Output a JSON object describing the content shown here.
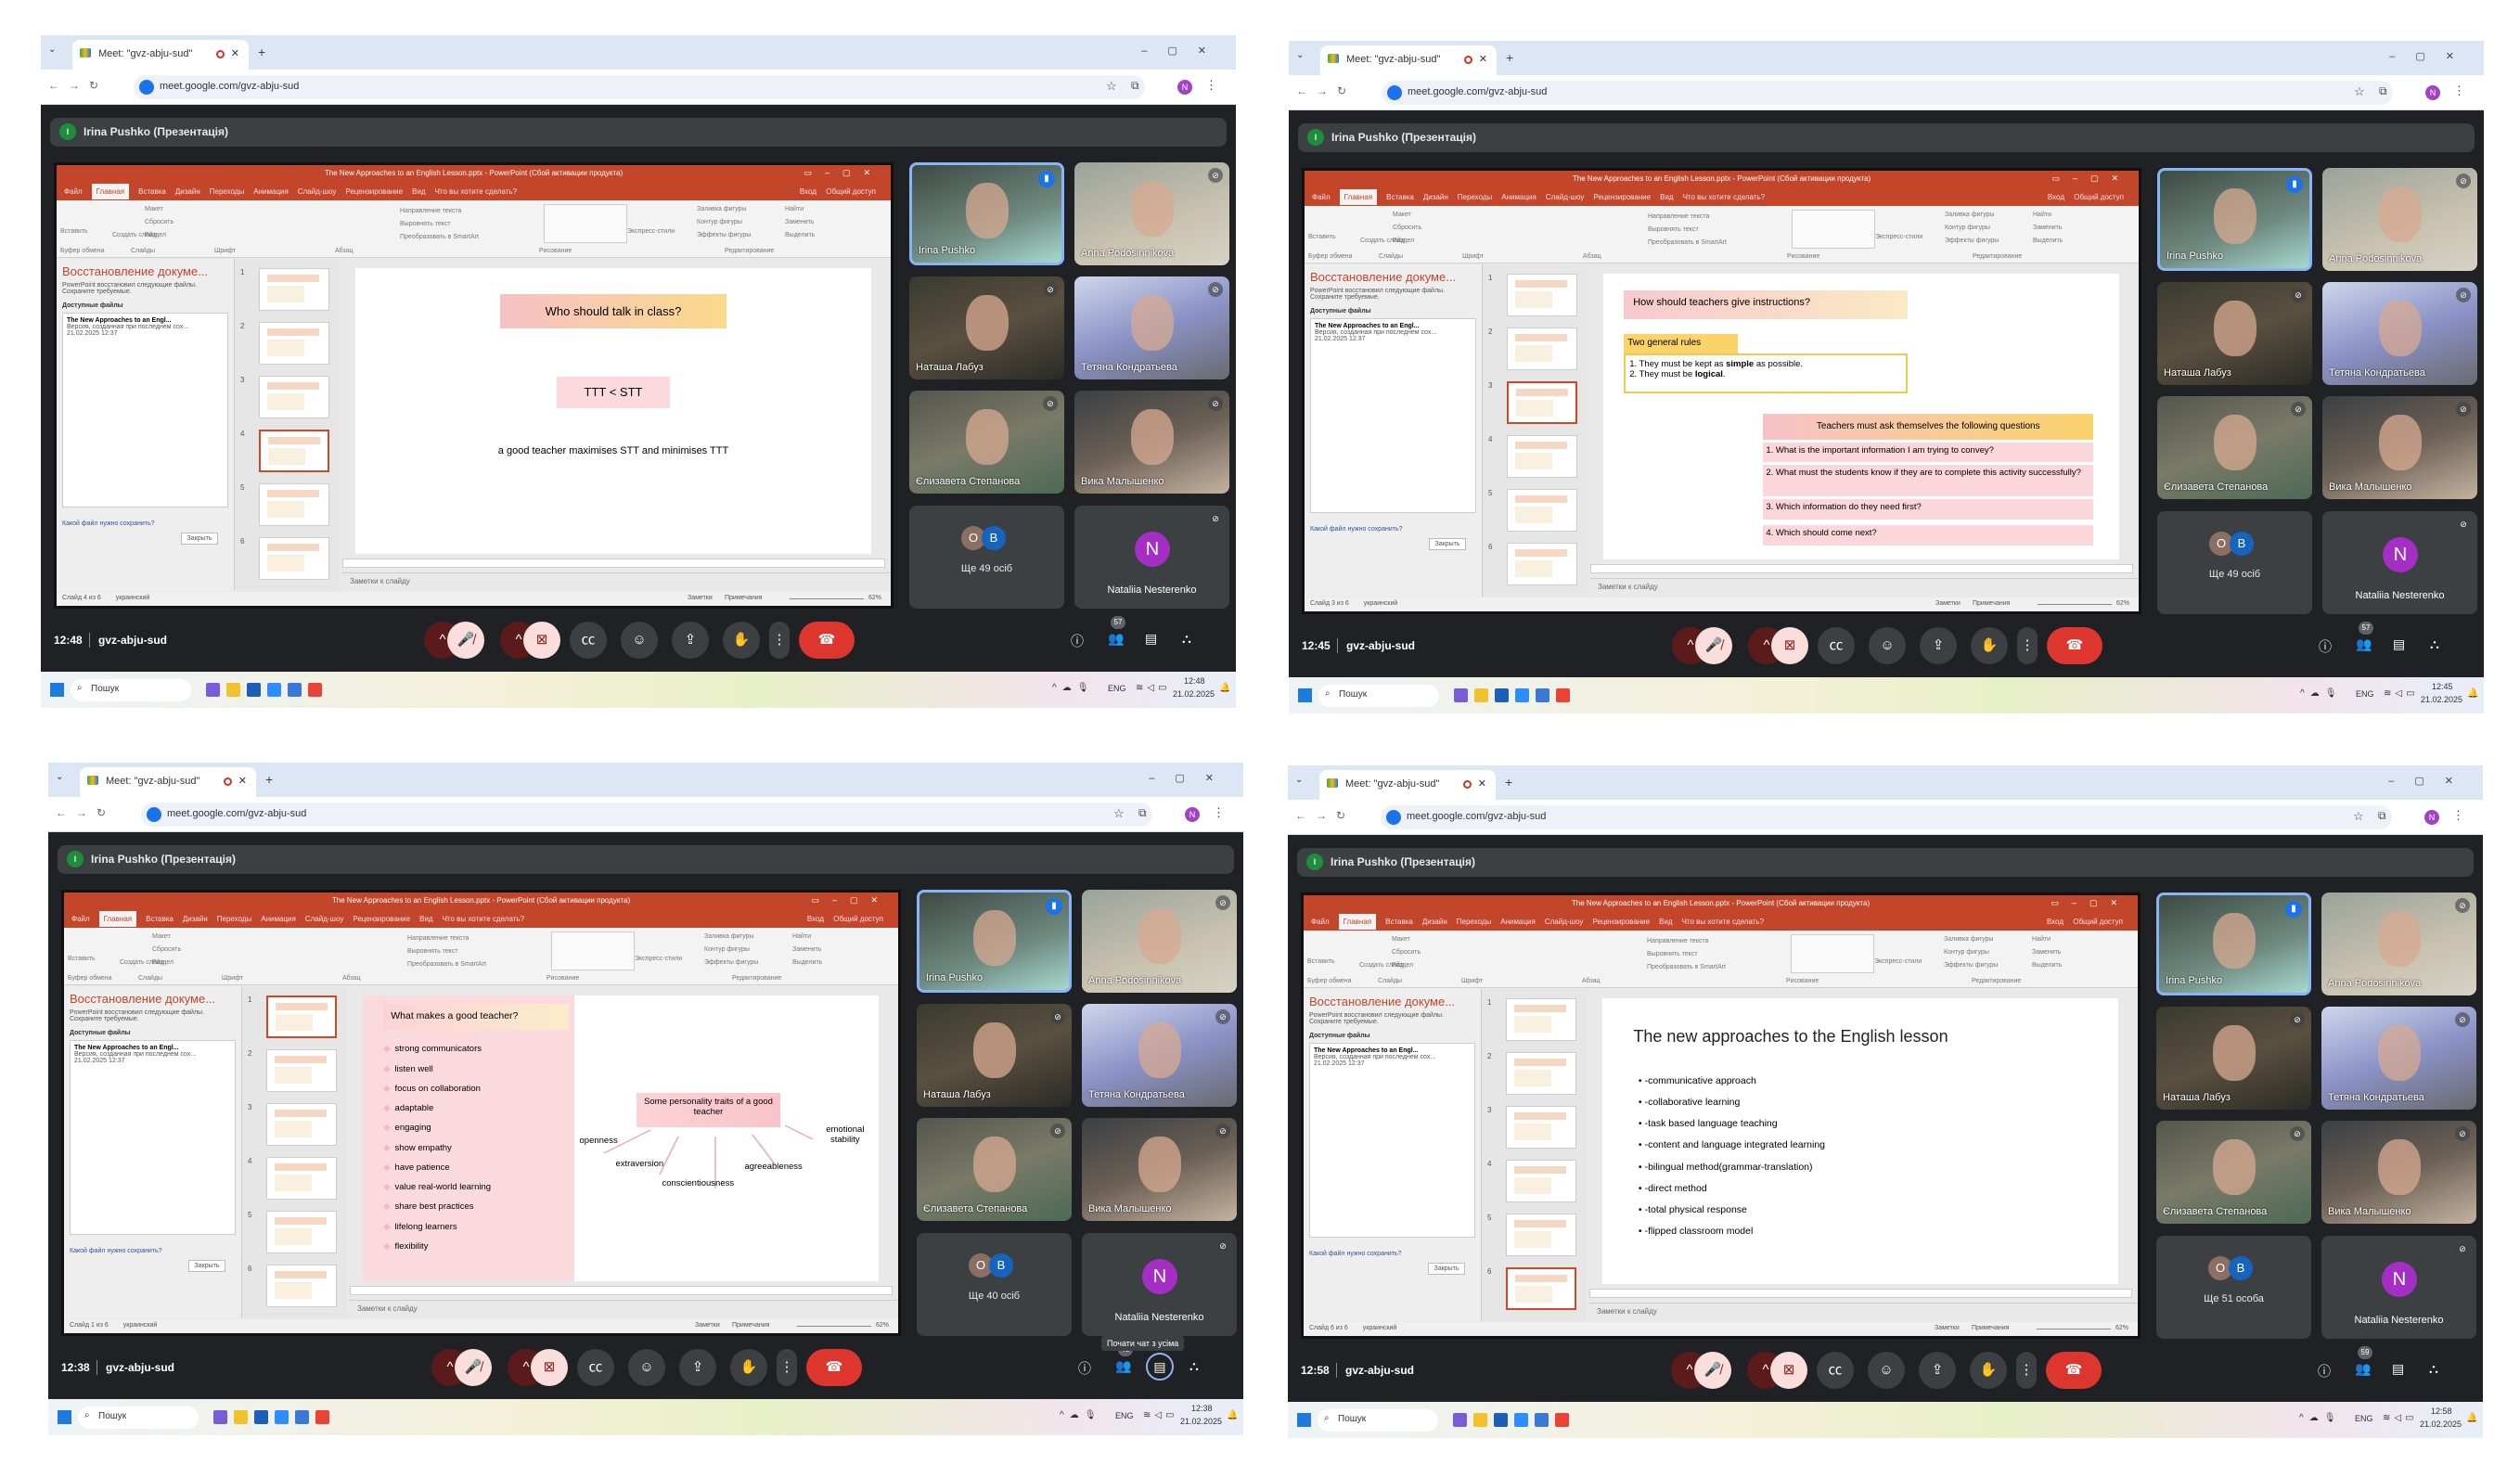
{
  "common": {
    "tab_title": "Meet: \"gvz-abju-sud\"",
    "url": "meet.google.com/gvz-abju-sud",
    "profile_initial": "N",
    "presenter_label": "Irina Pushko (Презентація)",
    "presenter_initial": "I",
    "ppt_title": "The New Approaches to an English Lesson.pptx - PowerPoint (Сбой активации продукта)",
    "ppt_menu": [
      "Файл",
      "Главная",
      "Вставка",
      "Дизайн",
      "Переходы",
      "Анимация",
      "Слайд-шоу",
      "Рецензирование",
      "Вид",
      "Что вы хотите сделать?"
    ],
    "ppt_signin": "Вход",
    "ppt_share": "Общий доступ",
    "ribbon_groups": [
      "Буфер обмена",
      "Слайды",
      "Шрифт",
      "Абзац",
      "Рисование",
      "Редактирование"
    ],
    "ribbon_items": [
      "Вставить",
      "Создать слайд",
      "Макет",
      "Сбросить",
      "Раздел",
      "Направление текста",
      "Выровнять текст",
      "Преобразовать в SmartArt",
      "Упорядочить",
      "Экспресс-стили",
      "Заливка фигуры",
      "Контур фигуры",
      "Эффекты фигуры",
      "Найти",
      "Заменить",
      "Выделить"
    ],
    "recovery": {
      "title": "Восстановление докуме...",
      "desc": "PowerPoint восстановил следующие файлы. Сохраните требуемые.",
      "available": "Доступные файлы",
      "file_name": "The New Approaches to an Engl...",
      "file_version": "Версия, созданная при последнем сох...",
      "file_date": "21.02.2025 12:37",
      "question": "Какой файл нужно сохранить?",
      "close": "Закрыть"
    },
    "thumbnails": [
      "1",
      "2",
      "3",
      "4",
      "5",
      "6"
    ],
    "notes": "Заметки к слайду",
    "status_lang": "украинский",
    "status_notes": "Заметки",
    "status_comments": "Примечания",
    "zoom": "62%",
    "participants": [
      {
        "name": "Irina Pushko",
        "speaking": true
      },
      {
        "name": "Anna Podosinnikova"
      },
      {
        "name": "Наташа Лабуз"
      },
      {
        "name": "Тетяна Кондратьева"
      },
      {
        "name": "Єлизавета Степанова"
      },
      {
        "name": "Вика Малышенко"
      }
    ],
    "others_avatars": [
      "O",
      "B"
    ],
    "named_tile": {
      "initial": "N",
      "name": "Nataliia Nesterenko"
    },
    "taskbar_search": "Пошук",
    "lang": "ENG",
    "colors": {
      "accent_blue": "#1a73e8",
      "end_call": "#dc362e",
      "ppt_orange": "#c4462a",
      "avatar_purple": "#a52fc4"
    }
  },
  "panels": [
    {
      "time": "12:48",
      "meeting_code": "gvz-abju-sud",
      "slide_status": "Слайд 4 из 6",
      "selected_thumb": 4,
      "people_count": "57",
      "others_label": "Ще 49 осіб",
      "clock": "12:48",
      "date": "21.02.2025",
      "slide": {
        "type": "talk",
        "title": "Who should talk in class?",
        "box": "TTT < STT",
        "sentence": "a good teacher maximises STT and minimises TTT"
      }
    },
    {
      "time": "12:45",
      "meeting_code": "gvz-abju-sud",
      "slide_status": "Слайд 3 из 6",
      "selected_thumb": 3,
      "people_count": "57",
      "others_label": "Ще 49 осіб",
      "clock": "12:45",
      "date": "21.02.2025",
      "slide": {
        "type": "instructions",
        "title": "How should teachers give instructions?",
        "rules_label": "Two general rules",
        "rules": [
          {
            "pre": "1. They must be kept as ",
            "bold": "simple",
            "post": " as possible."
          },
          {
            "pre": "2. They must be ",
            "bold": "logical",
            "post": "."
          }
        ],
        "questions_header": "Teachers must ask themselves  the following questions",
        "questions": [
          "1. What is the important information I am trying to convey?",
          "2. What must the students know if they are to complete this activity successfully?",
          "3. Which information do they need first?",
          "4. Which should come next?"
        ]
      }
    },
    {
      "time": "12:38",
      "meeting_code": "gvz-abju-sud",
      "slide_status": "Слайд 1 из 6",
      "selected_thumb": 1,
      "people_count": "48",
      "others_label": "Ще 40 осіб",
      "clock": "12:38",
      "date": "21.02.2025",
      "tooltip": "Почати чат з усіма",
      "slide": {
        "type": "teacher",
        "title": "What makes a good teacher?",
        "list": [
          "strong communicators",
          "listen well",
          "focus on collaboration",
          "adaptable",
          "engaging",
          "show empathy",
          "have patience",
          "value real-world learning",
          "share best practices",
          "lifelong learners",
          "flexibility"
        ],
        "traits_title": "Some personality traits of a good teacher",
        "traits": [
          "openness",
          "extraversion",
          "conscientiousness",
          "agreeableness",
          "emotional stability"
        ]
      }
    },
    {
      "time": "12:58",
      "meeting_code": "gvz-abju-sud",
      "slide_status": "Слайд 6 из 6",
      "selected_thumb": 6,
      "people_count": "59",
      "others_label": "Ще 51 особа",
      "clock": "12:58",
      "date": "21.02.2025",
      "slide": {
        "type": "approaches",
        "title": "The new approaches to the English lesson",
        "bullets": [
          "-communicative approach",
          "-collaborative learning",
          "-task based language teaching",
          "-content and language integrated learning",
          "-bilingual method(grammar-translation)",
          "-direct method",
          "-total physical response",
          "-flipped classroom model"
        ]
      }
    }
  ]
}
